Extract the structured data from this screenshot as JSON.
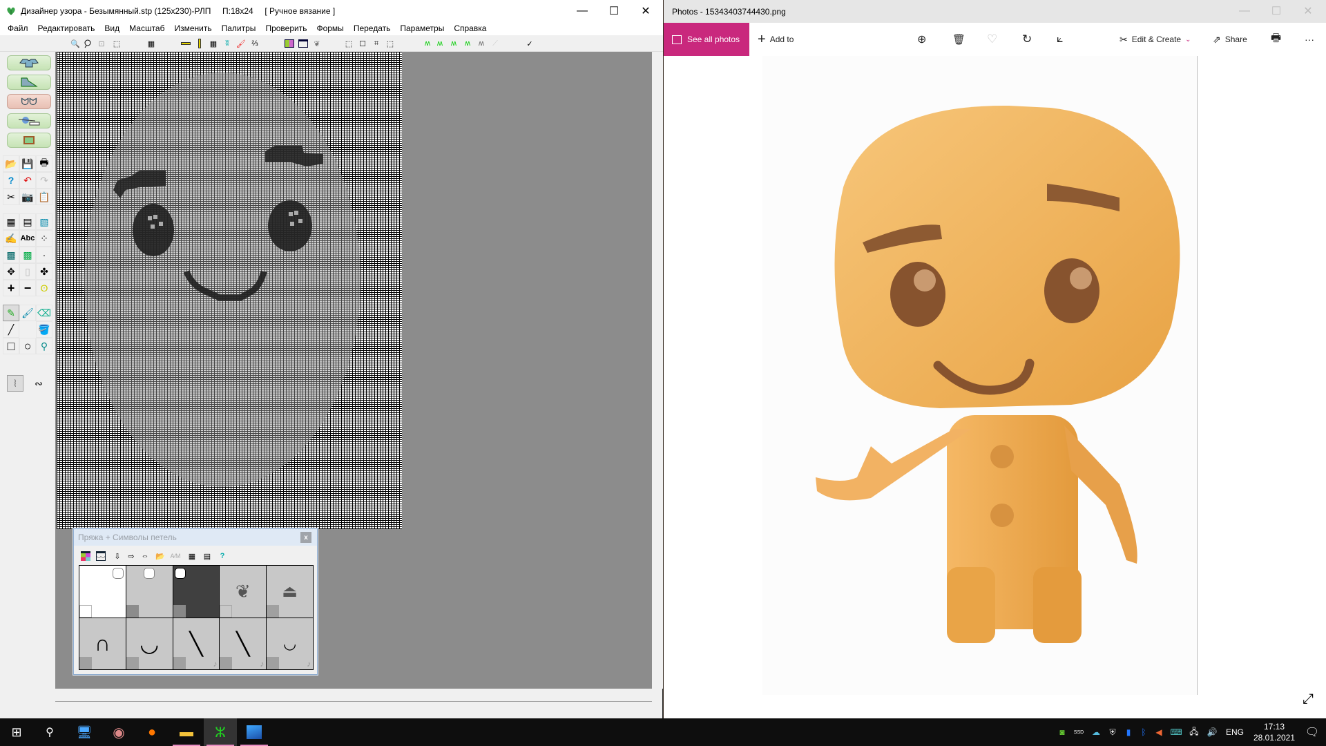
{
  "designer": {
    "title": "Дизайнер узора - Безымянный.stp (125x230)-РЛП     П:18x24     [ Ручное вязание ]",
    "menu": [
      "Файл",
      "Редактировать",
      "Вид",
      "Масштаб",
      "Изменить",
      "Палитры",
      "Проверить",
      "Формы",
      "Передать",
      "Параметры",
      "Справка"
    ],
    "toolbar_icons": [
      "zoom-in-icon",
      "zoom-out-icon",
      "zoom-fit-icon",
      "zoom-window-icon",
      "grid-icon",
      "ruler-h-icon",
      "ruler-v-icon",
      "grid-lines-icon",
      "stitch-icon",
      "color-palette-icon",
      "symbols-icon",
      "palette-grid-icon",
      "symbol-grid-icon",
      "repeat-icon",
      "select-rect-icon",
      "select-icon",
      "select-crop-icon",
      "select-extra-icon",
      "garment-1-icon",
      "garment-2-icon",
      "garment-3-icon",
      "garment-4-icon",
      "garment-gray-icon",
      "garment-disabled-icon",
      "check-icon"
    ],
    "mode_buttons": [
      "sweater-shape",
      "shaping-chart",
      "stitch-pattern",
      "yarn-machine",
      "picture-import"
    ],
    "left_tools": [
      [
        "open",
        "save",
        "print"
      ],
      [
        "help",
        "undo",
        "redo"
      ],
      [
        "cut",
        "camera",
        "paste"
      ],
      [
        "color-grid",
        "fill-grid",
        "symbols-grid"
      ],
      [
        "text-tool",
        "abc-text",
        "dots-tool"
      ],
      [
        "pattern-1",
        "pattern-2",
        "single-stitch"
      ],
      [
        "move",
        "frame",
        "rotate"
      ],
      [
        "plus",
        "minus",
        "lasso"
      ],
      [
        "pencil",
        "brush",
        "eraser"
      ],
      [
        "line",
        "",
        "fill-bucket"
      ],
      [
        "rectangle",
        "circle",
        "eyedropper"
      ]
    ],
    "extra_tools": [
      "freehand-dotted",
      "freehand-solid"
    ]
  },
  "yarn_palette": {
    "title": "Пряжа + Символы петель",
    "close_label": "x",
    "tools": [
      "palette-color-icon",
      "palette-symbols-icon",
      "arrow-down-icon",
      "arrow-right-icon",
      "arrow-both-icon",
      "folder-icon",
      "am-icon",
      "color-grid-icon",
      "gray-grid-icon",
      "help-icon"
    ],
    "colors": [
      "#ffffff",
      "#c8c8c8",
      "#404040",
      "#c8c8c8",
      "#c8c8c8"
    ],
    "stitch_symbols": [
      "∩",
      "◡",
      "╲",
      "╲",
      "◡"
    ]
  },
  "photos": {
    "title": "Photos - 15343403744430.png",
    "see_all": "See all photos",
    "add_to": "Add to",
    "edit_create": "Edit & Create",
    "share": "Share",
    "more": "···",
    "accent": "#c9287d"
  },
  "taskbar": {
    "apps": [
      "start",
      "search",
      "this-pc",
      "music-player",
      "firefox",
      "file-explorer",
      "pattern-designer",
      "photos"
    ],
    "language": "ENG",
    "time": "17:13",
    "date": "28.01.2021"
  }
}
